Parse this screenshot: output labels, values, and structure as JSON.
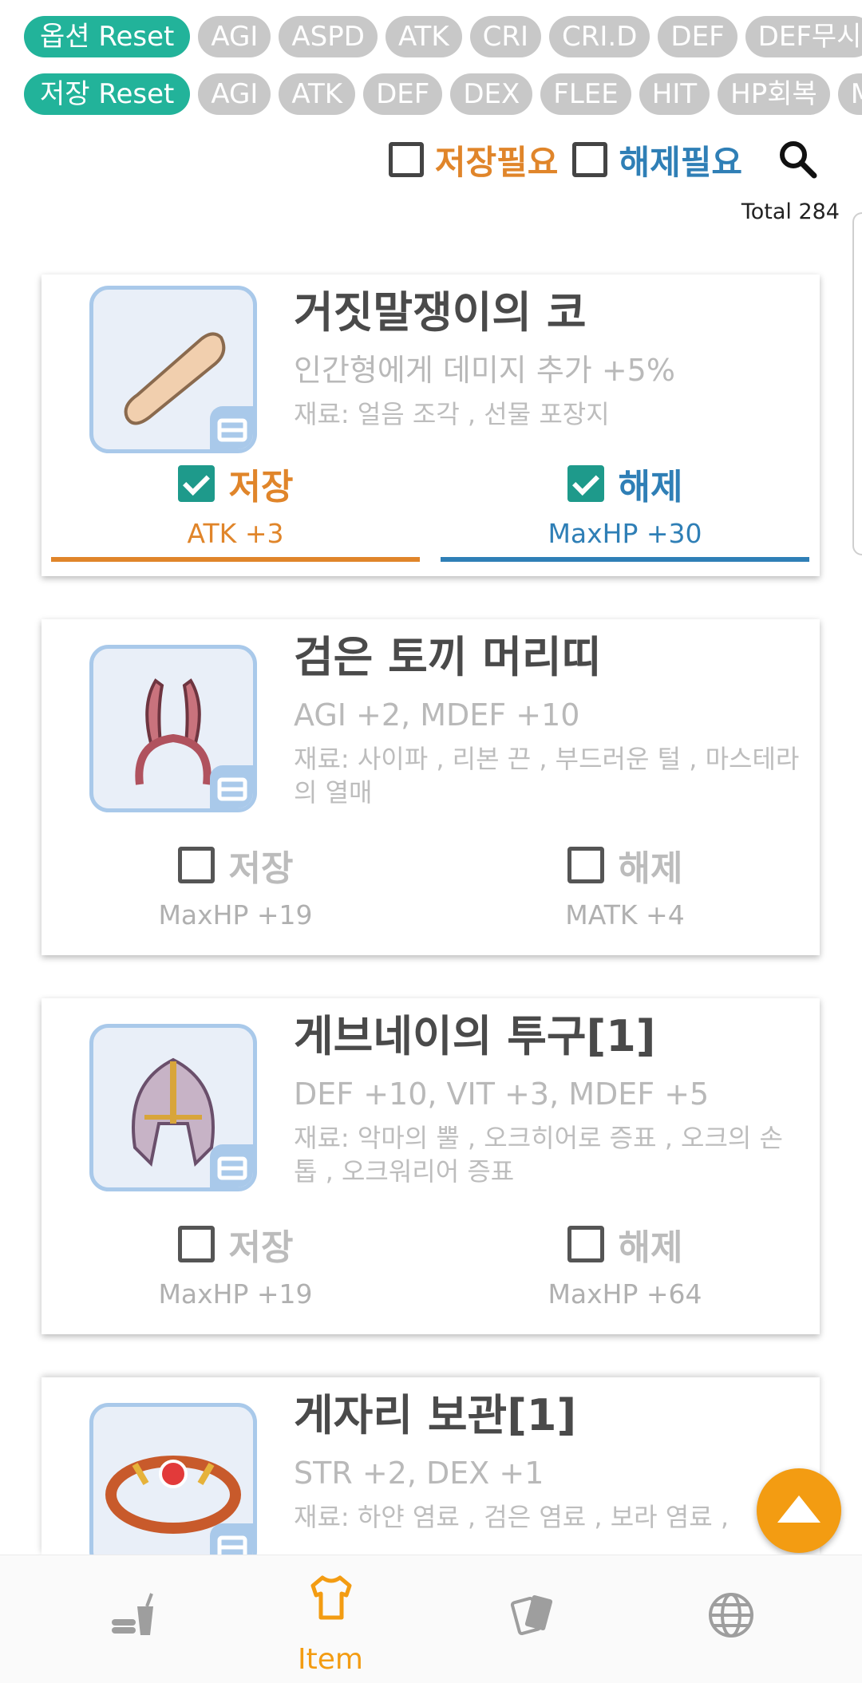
{
  "chips_row1": {
    "reset": "옵션 Reset",
    "items": [
      "AGI",
      "ASPD",
      "ATK",
      "CRI",
      "CRI.D",
      "DEF",
      "DEF무시"
    ]
  },
  "chips_row2": {
    "reset": "저장 Reset",
    "items": [
      "AGI",
      "ATK",
      "DEF",
      "DEX",
      "FLEE",
      "HIT",
      "HP회복",
      "MATK"
    ]
  },
  "filters": {
    "store_needed": "저장필요",
    "release_needed": "해제필요",
    "search_icon": "search-icon"
  },
  "total_text": "Total 284",
  "items": [
    {
      "name": "거짓말쟁이의 코",
      "effect": "인간형에게 데미지 추가 +5%",
      "materials": "재료: 얼음 조각 , 선물 포장지",
      "store": {
        "label": "저장",
        "checked": true,
        "stat": "ATK +3"
      },
      "release": {
        "label": "해제",
        "checked": true,
        "stat": "MaxHP +30"
      }
    },
    {
      "name": "검은 토끼 머리띠",
      "effect": "AGI +2, MDEF +10",
      "materials": "재료: 사이파 , 리본 끈 , 부드러운 털 , 마스테라의 열매",
      "store": {
        "label": "저장",
        "checked": false,
        "stat": "MaxHP +19"
      },
      "release": {
        "label": "해제",
        "checked": false,
        "stat": "MATK +4"
      }
    },
    {
      "name": "게브네이의 투구[1]",
      "effect": "DEF +10, VIT +3, MDEF +5",
      "materials": "재료: 악마의 뿔 , 오크히어로 증표 , 오크의 손톱 , 오크워리어 증표",
      "store": {
        "label": "저장",
        "checked": false,
        "stat": "MaxHP +19"
      },
      "release": {
        "label": "해제",
        "checked": false,
        "stat": "MaxHP +64"
      }
    },
    {
      "name": "게자리 보관[1]",
      "effect": "STR +2, DEX +1",
      "materials": "재료: 하얀 염료 , 검은 염료 , 보라 염료 ,"
    }
  ],
  "nav": {
    "active_label": "Item",
    "tabs": [
      "food-icon",
      "shirt-icon",
      "cards-icon",
      "globe-icon"
    ]
  },
  "colors": {
    "accent_orange": "#e0852a",
    "accent_blue": "#2f7fb6",
    "teal": "#22b39a",
    "fab": "#f39c12"
  }
}
